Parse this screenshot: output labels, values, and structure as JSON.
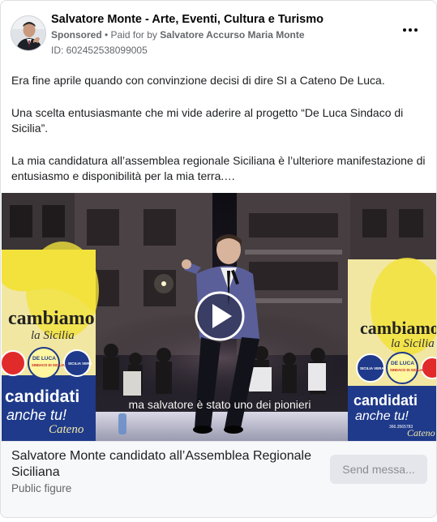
{
  "ad": {
    "page_name": "Salvatore Monte - Arte, Eventi, Cultura e Turismo",
    "sponsored_label": "Sponsored",
    "paid_prefix": "• Paid for by",
    "payer": "Salvatore Accurso Maria Monte",
    "ad_id": "ID: 602452538099005",
    "more_icon": "more-options-icon"
  },
  "body": {
    "paragraphs": [
      "Era fine aprile quando con convinzione decisi di dire SI a Cateno De Luca.",
      "Una scelta entusiasmante che mi vide aderire al progetto “De Luca Sindaco di Sicilia”.",
      "La mia candidatura all’assemblea regionale Siciliana è l’ulteriore manifestazione di entusiasmo e disponibilità per la mia terra.…"
    ]
  },
  "video": {
    "subtitle": "ma salvatore  è  stato uno dei pionieri",
    "banner_left": {
      "line1": "cambiamo",
      "line2": "la Sicilia",
      "badge1_a": "DE LUCA",
      "badge1_b": "SINDACO DI SICILIA",
      "badge2": "SICILIA VERA",
      "candidati": "candidati",
      "anche": "anche tu!",
      "signature": "Cateno"
    },
    "banner_right": {
      "line1": "cambiamo",
      "line2": "la Sicilia",
      "badge1": "SICILIA VERA",
      "badge2_a": "DE LUCA",
      "badge2_b": "SINDACO DI SICILIA",
      "candidati": "candidati",
      "anche": "anche tu!",
      "phone": "366.3565783",
      "signature": "Cateno"
    },
    "play_icon": "play-icon"
  },
  "footer": {
    "title": "Salvatore Monte candidato all’Assemblea Regionale Siciliana",
    "subtitle": "Public figure",
    "cta_label": "Send messa..."
  },
  "colors": {
    "accent_yellow": "#f3e23c",
    "banner_blue": "#1f3a8a",
    "muted_text": "#65676b"
  }
}
